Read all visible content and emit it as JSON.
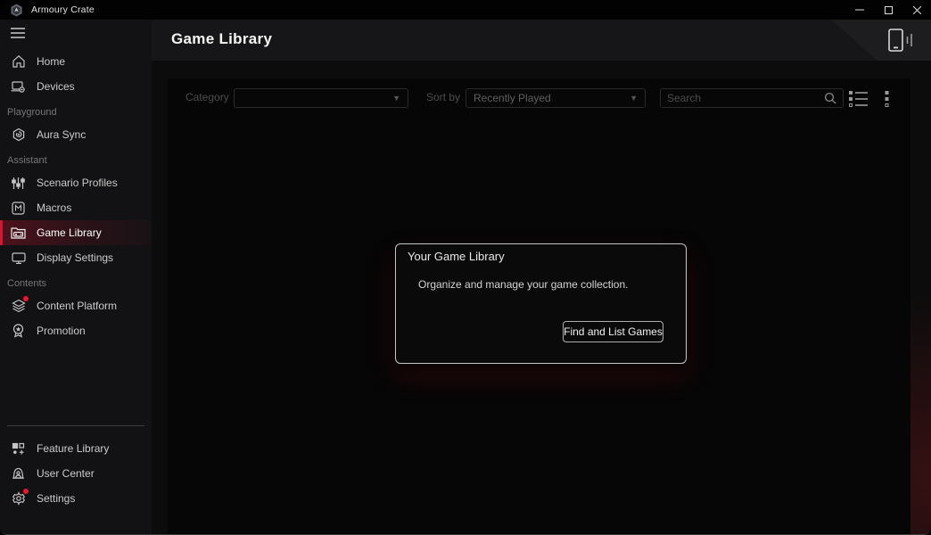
{
  "window": {
    "title": "Armoury Crate",
    "controls": [
      {
        "name": "minimize"
      },
      {
        "name": "maximize"
      },
      {
        "name": "close"
      }
    ]
  },
  "sidebar": {
    "sections": [
      "Playground",
      "Assistant",
      "Contents"
    ],
    "items": [
      {
        "label": "Home",
        "icon": "home-icon"
      },
      {
        "label": "Devices",
        "icon": "devices-icon"
      },
      {
        "label": "Aura Sync",
        "icon": "aura-sync-icon"
      },
      {
        "label": "Scenario Profiles",
        "icon": "sliders-icon"
      },
      {
        "label": "Macros",
        "icon": "macro-icon"
      },
      {
        "label": "Game Library",
        "icon": "game-folder-icon",
        "active": true
      },
      {
        "label": "Display Settings",
        "icon": "monitor-icon"
      },
      {
        "label": "Content Platform",
        "icon": "layers-icon",
        "badge": true
      },
      {
        "label": "Promotion",
        "icon": "medal-icon"
      },
      {
        "label": "Feature Library",
        "icon": "feature-grid-icon"
      },
      {
        "label": "User Center",
        "icon": "user-bell-icon"
      },
      {
        "label": "Settings",
        "icon": "gear-icon",
        "badge": true
      }
    ]
  },
  "header": {
    "title": "Game Library",
    "corner_icon": "mobile-device-icon"
  },
  "toolbar": {
    "category_label": "Category",
    "category_value": "",
    "sort_label": "Sort by",
    "sort_value": "Recently Played",
    "search_placeholder": "Search",
    "view_icons": [
      "list-view-icon",
      "tile-view-icon"
    ]
  },
  "dialog": {
    "title": "Your Game Library",
    "body": "Organize and manage your game collection.",
    "button_label": "Find and List Games"
  },
  "colors": {
    "accent": "#d8142e",
    "badge": "#e8192e",
    "sidebar_bg": "#121214",
    "header_bg": "#161618",
    "panel_bg": "#060606"
  }
}
